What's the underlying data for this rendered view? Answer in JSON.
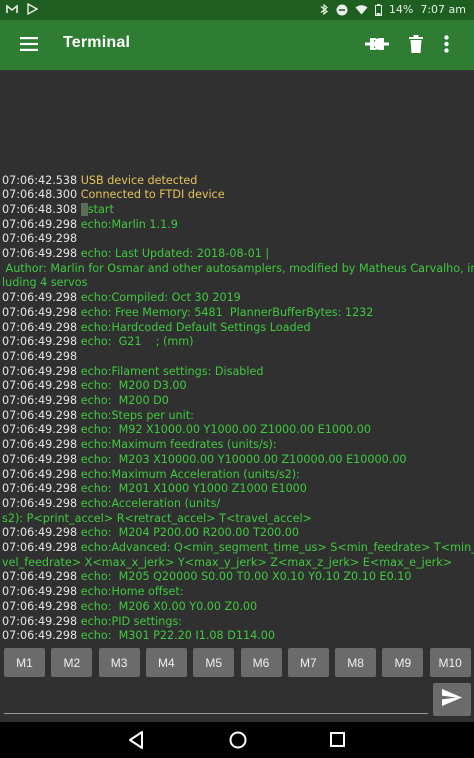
{
  "status_bar": {
    "battery": "14%",
    "time": "7:07 am"
  },
  "app_bar": {
    "title": "Terminal",
    "icons": [
      "menu-icon",
      "connect-icon",
      "delete-icon",
      "more-vert-icon"
    ]
  },
  "terminal": {
    "lines": [
      {
        "ts": "07:06:42.538",
        "msg": "USB device detected",
        "color": "yellow"
      },
      {
        "ts": "07:06:48.300",
        "msg": "Connected to FTDI device",
        "color": "yellow"
      },
      {
        "ts": "07:06:48.308",
        "msg": "start",
        "color": "green",
        "cursor": true
      },
      {
        "ts": "07:06:49.298",
        "msg": "echo:Marlin 1.1.9",
        "color": "green"
      },
      {
        "ts": "07:06:49.298",
        "msg": "",
        "color": "green"
      },
      {
        "ts": "07:06:49.298",
        "msg": "echo: Last Updated: 2018-08-01 |",
        "color": "green"
      },
      {
        "ts": "",
        "msg": " Author: Marlin for Osmar and other autosamplers, modified by Matheus Carvalho, inc",
        "color": "green"
      },
      {
        "ts": "",
        "msg": "luding 4 servos",
        "color": "green"
      },
      {
        "ts": "07:06:49.298",
        "msg": "echo:Compiled: Oct 30 2019",
        "color": "green"
      },
      {
        "ts": "07:06:49.298",
        "msg": "echo: Free Memory: 5481  PlannerBufferBytes: 1232",
        "color": "green"
      },
      {
        "ts": "07:06:49.298",
        "msg": "echo:Hardcoded Default Settings Loaded",
        "color": "green"
      },
      {
        "ts": "07:06:49.298",
        "msg": "echo:  G21    ; (mm)",
        "color": "green"
      },
      {
        "ts": "07:06:49.298",
        "msg": "",
        "color": "green"
      },
      {
        "ts": "07:06:49.298",
        "msg": "echo:Filament settings: Disabled",
        "color": "green"
      },
      {
        "ts": "07:06:49.298",
        "msg": "echo:  M200 D3.00",
        "color": "green"
      },
      {
        "ts": "07:06:49.298",
        "msg": "echo:  M200 D0",
        "color": "green"
      },
      {
        "ts": "07:06:49.298",
        "msg": "echo:Steps per unit:",
        "color": "green"
      },
      {
        "ts": "07:06:49.298",
        "msg": "echo:  M92 X1000.00 Y1000.00 Z1000.00 E1000.00",
        "color": "green"
      },
      {
        "ts": "07:06:49.298",
        "msg": "echo:Maximum feedrates (units/s):",
        "color": "green"
      },
      {
        "ts": "07:06:49.298",
        "msg": "echo:  M203 X10000.00 Y10000.00 Z10000.00 E10000.00",
        "color": "green"
      },
      {
        "ts": "07:06:49.298",
        "msg": "echo:Maximum Acceleration (units/s2):",
        "color": "green"
      },
      {
        "ts": "07:06:49.298",
        "msg": "echo:  M201 X1000 Y1000 Z1000 E1000",
        "color": "green"
      },
      {
        "ts": "07:06:49.298",
        "msg": "echo:Acceleration (units/",
        "color": "green"
      },
      {
        "ts": "",
        "msg": "s2): P<print_accel> R<retract_accel> T<travel_accel>",
        "color": "green"
      },
      {
        "ts": "07:06:49.298",
        "msg": "echo:  M204 P200.00 R200.00 T200.00",
        "color": "green"
      },
      {
        "ts": "07:06:49.298",
        "msg": "echo:Advanced: Q<min_segment_time_us> S<min_feedrate> T<min_tra",
        "color": "green"
      },
      {
        "ts": "",
        "msg": "vel_feedrate> X<max_x_jerk> Y<max_y_jerk> Z<max_z_jerk> E<max_e_jerk>",
        "color": "green"
      },
      {
        "ts": "07:06:49.298",
        "msg": "echo:  M205 Q20000 S0.00 T0.00 X0.10 Y0.10 Z0.10 E0.10",
        "color": "green"
      },
      {
        "ts": "07:06:49.298",
        "msg": "echo:Home offset:",
        "color": "green"
      },
      {
        "ts": "07:06:49.298",
        "msg": "echo:  M206 X0.00 Y0.00 Z0.00",
        "color": "green"
      },
      {
        "ts": "07:06:49.298",
        "msg": "echo:PID settings:",
        "color": "green"
      },
      {
        "ts": "07:06:49.298",
        "msg": "echo:  M301 P22.20 I1.08 D114.00",
        "color": "green"
      }
    ]
  },
  "macros": [
    "M1",
    "M2",
    "M3",
    "M4",
    "M5",
    "M6",
    "M7",
    "M8",
    "M9",
    "M10"
  ],
  "input": {
    "value": "",
    "placeholder": ""
  },
  "colors": {
    "app_bar": "#2e7d32",
    "status_bar": "#1e5e20",
    "terminal_bg": "#303030",
    "text_green": "#3fc93f",
    "text_yellow": "#e6c35a",
    "button_bg": "#6b6b6b"
  }
}
